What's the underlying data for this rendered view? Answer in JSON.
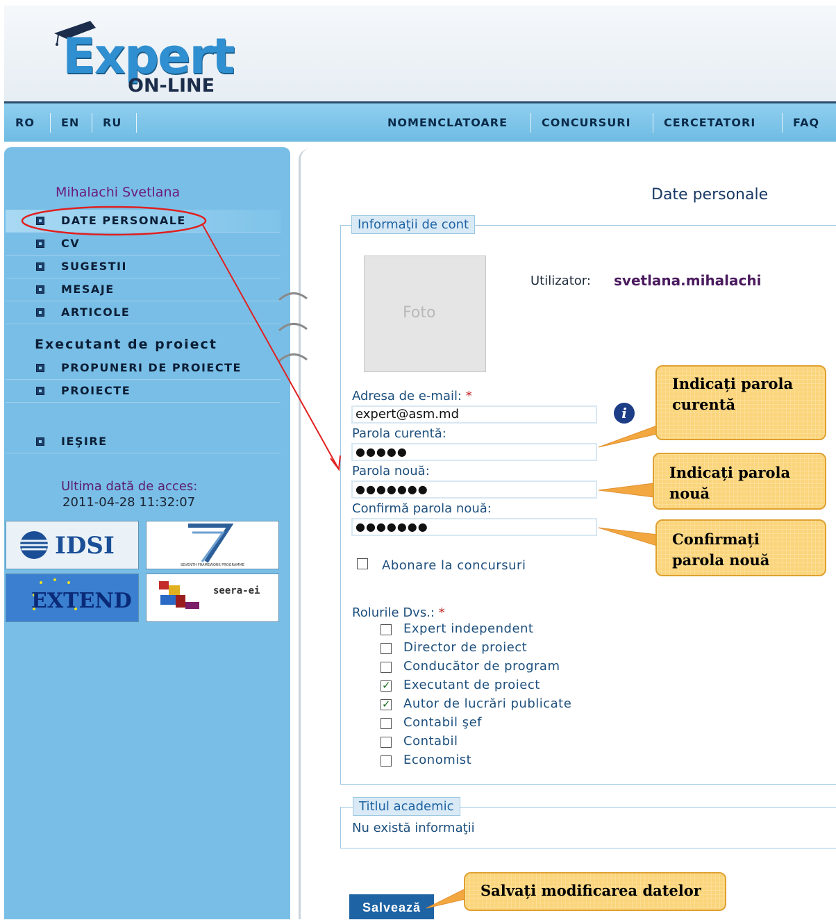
{
  "header": {
    "logo_main": "Expert",
    "logo_sub": "ON-LINE"
  },
  "lang_nav": [
    "RO",
    "EN",
    "RU"
  ],
  "top_nav": [
    "NOMENCLATOARE",
    "CONCURSURI",
    "CERCETATORI",
    "FAQ"
  ],
  "sidebar": {
    "user_name": "Mihalachi Svetlana",
    "items": [
      {
        "label": "DATE PERSONALE"
      },
      {
        "label": "CV"
      },
      {
        "label": "SUGESTII"
      },
      {
        "label": "MESAJE"
      },
      {
        "label": "ARTICOLE"
      }
    ],
    "section_label": "Executant de proiect",
    "section_items": [
      {
        "label": "PROPUNERI DE PROIECTE"
      },
      {
        "label": "PROIECTE"
      }
    ],
    "exit_label": "IEŞIRE",
    "last_access_label": "Ultima dată de acces:",
    "last_access_date": "2011-04-28 11:32:07",
    "partners": [
      "IDSI",
      "SEVENTH FRAMEWORK PROGRAMME",
      "EXTEND",
      "seera-ei"
    ]
  },
  "main": {
    "page_title": "Date personale",
    "account_legend": "Informaţii de cont",
    "photo_label": "Foto",
    "user_label": "Utilizator:",
    "user_value": "svetlana.mihalachi",
    "email_label": "Adresa de e-mail:",
    "email_value": "expert@asm.md",
    "current_pw_label": "Parola curentă:",
    "current_pw_value": "●●●●●",
    "new_pw_label": "Parola nouă:",
    "new_pw_value": "●●●●●●●",
    "confirm_pw_label": "Confirmă parola nouă:",
    "confirm_pw_value": "●●●●●●●",
    "subscribe_label": "Abonare la concursuri",
    "subscribe_checked": false,
    "roles_label": "Rolurile Dvs.:",
    "required_mark": "*",
    "roles": [
      {
        "label": "Expert independent",
        "checked": false
      },
      {
        "label": "Director de proiect",
        "checked": false
      },
      {
        "label": "Conducător de program",
        "checked": false
      },
      {
        "label": "Executant de proiect",
        "checked": true
      },
      {
        "label": "Autor de lucrări publicate",
        "checked": true
      },
      {
        "label": "Contabil şef",
        "checked": false
      },
      {
        "label": "Contabil",
        "checked": false
      },
      {
        "label": "Economist",
        "checked": false
      }
    ],
    "academic_legend": "Titlul academic",
    "academic_value": "Nu există informaţii",
    "save_label": "Salvează"
  },
  "callouts": {
    "current_pw": [
      "Indicați parola",
      "curentă"
    ],
    "new_pw": [
      "Indicați parola",
      "nouă"
    ],
    "confirm_pw": [
      "Confirmați",
      "parola nouă"
    ],
    "save": [
      "Salvați modificarea datelor"
    ]
  },
  "colors": {
    "sidebar_bg": "#79bee6",
    "nav_bg": "#8fcfef",
    "accent_blue": "#1e63a3",
    "callout_bg": "#fbd57c",
    "annotation_red": "#e02020"
  }
}
